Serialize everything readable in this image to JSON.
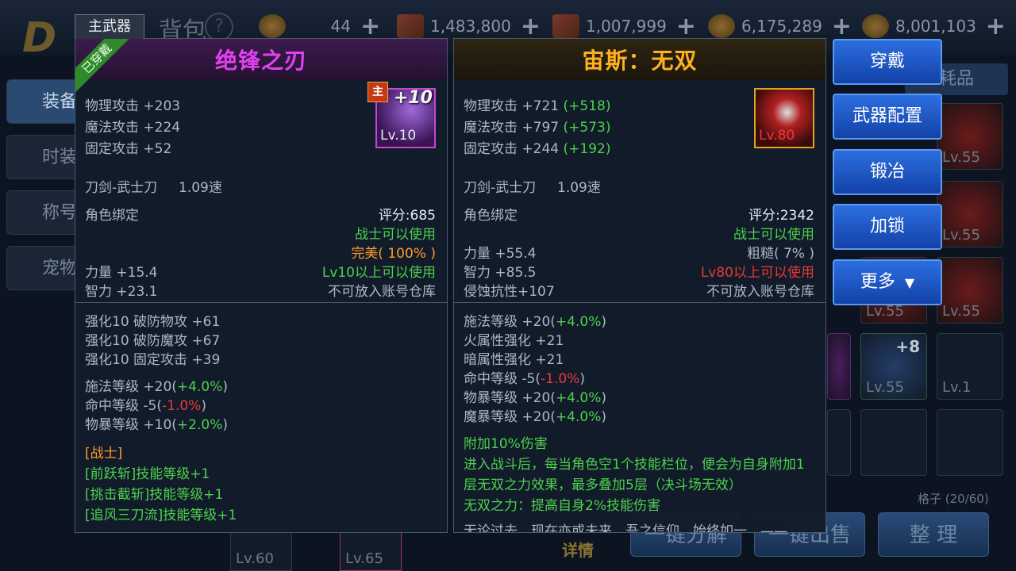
{
  "header": {
    "title": "背包",
    "currencies": [
      {
        "icon": "coin-icon",
        "value": "44"
      },
      {
        "icon": "scroll-icon",
        "value": "1,483,800"
      },
      {
        "icon": "scroll-icon",
        "value": "1,007,999"
      },
      {
        "icon": "coin-icon",
        "value": "6,175,289"
      },
      {
        "icon": "coin-icon",
        "value": "8,001,103"
      }
    ],
    "plus": "+"
  },
  "side_tabs": [
    "装备",
    "时装",
    "称号",
    "宠物"
  ],
  "bg_labels": {
    "consumables_tab": "耗品",
    "grid_count": "格子 (20/60)",
    "auto_decompose": "一键分解",
    "auto_sell": "一键出售",
    "sort": "整 理",
    "detail": "详情"
  },
  "grid": {
    "lv55": "Lv.55",
    "lv1": "Lv.1",
    "plus8": "+8",
    "lv60": "Lv.60",
    "lv65": "Lv.65"
  },
  "left_item": {
    "tag": "主武器",
    "equipped": "已穿戴",
    "name": "绝锋之刃",
    "main_badge": "主",
    "level": "Lv.10",
    "enhance": "+10",
    "stats": [
      "物理攻击 +203",
      "魔法攻击 +224",
      "固定攻击 +52"
    ],
    "type": "刀剑-武士刀",
    "speed": "1.09速",
    "bind": "角色绑定",
    "score": "评分:685",
    "class_req": "战士可以使用",
    "quality": "完美( 100% )",
    "str": "力量 +15.4",
    "level_req": "Lv10以上可以使用",
    "int": "智力 +23.1",
    "storage": "不可放入账号仓库",
    "enh_stats": [
      "强化10 破防物攻 +61",
      "强化10 破防魔攻 +67",
      "强化10 固定攻击 +39"
    ],
    "extra": [
      {
        "label": "施法等级 +20(",
        "bonus": "+4.0%",
        "end": ")",
        "color": "green"
      },
      {
        "label": "命中等级 -5(",
        "bonus": "-1.0%",
        "end": ")",
        "color": "red"
      },
      {
        "label": "物暴等级 +10(",
        "bonus": "+2.0%",
        "end": ")",
        "color": "green"
      }
    ],
    "class_header": "[战士]",
    "skills": [
      "[前跃斩]技能等级+1",
      "[挑击截斩]技能等级+1",
      "[追风三刀流]技能等级+1"
    ]
  },
  "right_item": {
    "name": "宙斯：无双",
    "level": "Lv.80",
    "stats": [
      {
        "text": "物理攻击 +721",
        "diff": "(+518)"
      },
      {
        "text": "魔法攻击 +797",
        "diff": "(+573)"
      },
      {
        "text": "固定攻击 +244",
        "diff": "(+192)"
      }
    ],
    "type": "刀剑-武士刀",
    "speed": "1.09速",
    "bind": "角色绑定",
    "score": "评分:2342",
    "class_req": "战士可以使用",
    "quality": "粗糙( 7% )",
    "str": "力量 +55.4",
    "level_req": "Lv80以上可以使用",
    "int": "智力 +85.5",
    "storage": "不可放入账号仓库",
    "erosion": "侵蚀抗性+107",
    "extra": [
      {
        "label": "施法等级 +20(",
        "bonus": "+4.0%",
        "end": ")",
        "color": "green"
      },
      {
        "label": "火属性强化 +21",
        "bonus": "",
        "end": "",
        "color": "green"
      },
      {
        "label": "暗属性强化 +21",
        "bonus": "",
        "end": "",
        "color": "green"
      },
      {
        "label": "命中等级 -5(",
        "bonus": "-1.0%",
        "end": ")",
        "color": "red"
      },
      {
        "label": "物暴等级 +20(",
        "bonus": "+4.0%",
        "end": ")",
        "color": "green"
      },
      {
        "label": "魔暴等级 +20(",
        "bonus": "+4.0%",
        "end": ")",
        "color": "green"
      }
    ],
    "effects": [
      "附加10%伤害",
      "进入战斗后，每当角色空1个技能栏位，便会为自身附加1",
      "层无双之力效果，最多叠加5层（决斗场无效）",
      "无双之力：提高自身2%技能伤害"
    ],
    "flavor": "无论过去，现在亦或未来，吾之信仰，始终如一。——"
  },
  "actions": [
    "穿戴",
    "武器配置",
    "锻冶",
    "加锁",
    "更多"
  ]
}
